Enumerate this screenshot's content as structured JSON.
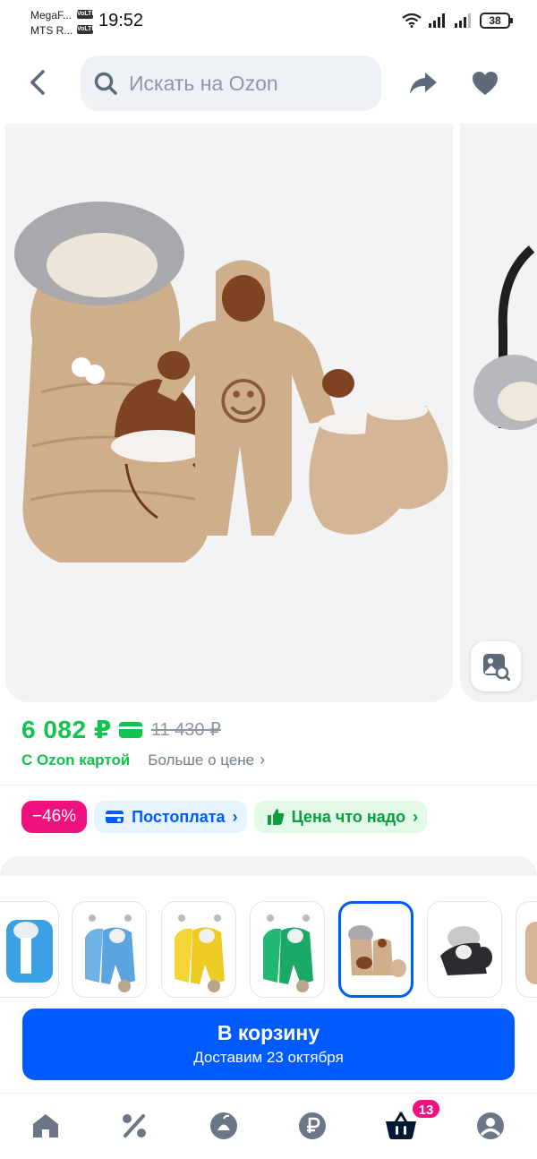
{
  "status_bar": {
    "carrier1": "MegaF...",
    "carrier2": "MTS R...",
    "volte_label": "VoLTE",
    "time": "19:52",
    "battery": "38"
  },
  "search": {
    "placeholder": "Искать на Ozon"
  },
  "product": {
    "price": "6 082 ₽",
    "old_price": "11 430 ₽",
    "ozon_card_label": "С Ozon картой",
    "more_about_price": "Больше о цене",
    "discount_badge": "−46%",
    "postpay_badge": "Постоплата",
    "good_price_badge": "Цена что надо",
    "colors": {
      "price_green": "#10c44c",
      "ozon_blue": "#005bff",
      "discount_pink": "#f1117e"
    }
  },
  "variants": [
    {
      "color_name": "blue",
      "selected": false
    },
    {
      "color_name": "blue",
      "selected": false
    },
    {
      "color_name": "yellow",
      "selected": false
    },
    {
      "color_name": "green",
      "selected": false
    },
    {
      "color_name": "beige",
      "selected": true
    },
    {
      "color_name": "black",
      "selected": false
    },
    {
      "color_name": "beige",
      "selected": false
    }
  ],
  "cart_button": {
    "title": "В корзину",
    "subtitle": "Доставим 23 октября"
  },
  "bottom_nav": {
    "cart_count": "13",
    "icons": [
      "home-icon",
      "percent-icon",
      "fresh-icon",
      "ruble-icon",
      "cart-icon",
      "profile-icon"
    ]
  }
}
